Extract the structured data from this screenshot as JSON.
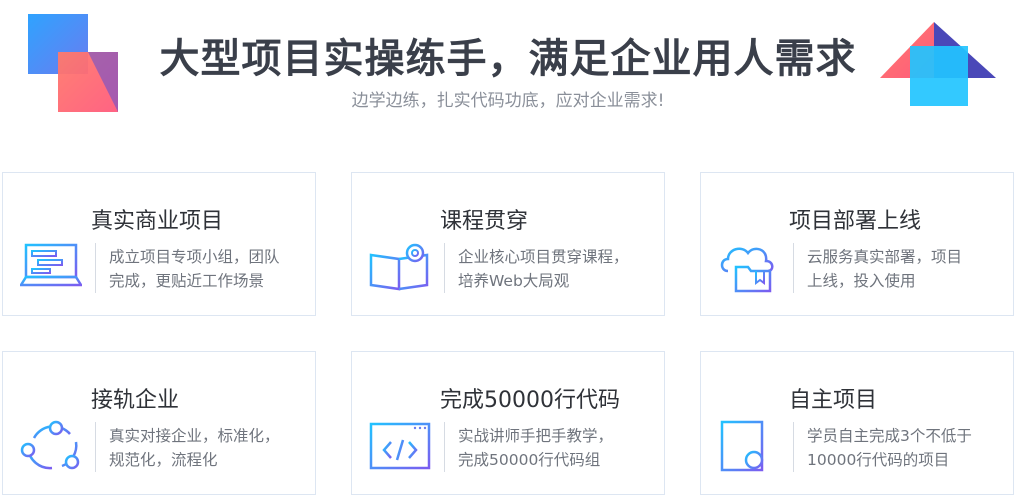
{
  "header": {
    "title": "大型项目实操练手，满足企业用人需求",
    "subtitle": "边学边练，扎实代码功底，应对企业需求!"
  },
  "cards": [
    {
      "title": "真实商业项目",
      "desc_line1": "成立项目专项小组，团队",
      "desc_line2": "完成，更贴近工作场景",
      "icon": "laptop-code-icon"
    },
    {
      "title": "课程贯穿",
      "desc_line1": "企业核心项目贯穿课程，",
      "desc_line2": "培养Web大局观",
      "icon": "book-gear-icon"
    },
    {
      "title": "项目部署上线",
      "desc_line1": "云服务真实部署，项目",
      "desc_line2": "上线，投入使用",
      "icon": "cloud-folder-icon"
    },
    {
      "title": "接轨企业",
      "desc_line1": "真实对接企业，标准化，",
      "desc_line2": "规范化，流程化",
      "icon": "network-nodes-icon"
    },
    {
      "title": "完成50000行代码",
      "desc_line1": "实战讲师手把手教学，",
      "desc_line2": "完成50000行代码组",
      "icon": "code-window-icon"
    },
    {
      "title": "自主项目",
      "desc_line1": "学员自主完成3个不低于",
      "desc_line2": "10000行代码的项目",
      "icon": "document-certificate-icon"
    }
  ]
}
